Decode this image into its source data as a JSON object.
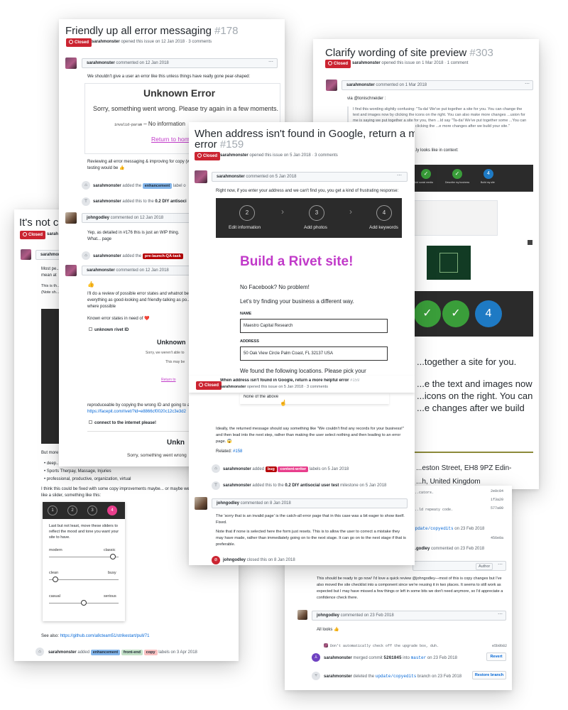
{
  "card1": {
    "title": "Friendly up all error messaging",
    "number": "#178",
    "status": "Closed",
    "meta_user": "sarahmonster",
    "meta_text": "opened this issue on 12 Jan 2018 · 3 comments",
    "comment1": {
      "user": "sarahmonster",
      "date": "commented on 12 Jan 2018"
    },
    "intro": "We shouldn't give a user an error like this unless things have really gone pear-shaped:",
    "err_title": "Unknown Error",
    "err_text": "Sorry, something went wrong. Please try again in a few moments.",
    "err_code_prefix": "invalid-param",
    "err_code_suffix": "– No information",
    "err_link": "Return to hom",
    "review_text": "Reviewing all error messaging & improving for copy (w... testing would be 👍",
    "event1": {
      "user": "sarahmonster",
      "pre": "added the",
      "label": "enhancement",
      "post": "label o"
    },
    "event2": {
      "user": "sarahmonster",
      "pre": "added this to the",
      "milestone": "0.2 DIY antisoci"
    },
    "comment2": {
      "user": "johngodley",
      "date": "commented on 12 Jan 2018"
    },
    "comment2_text": "Yep, as detailed in #176 this is just an WIP thing. What... page",
    "comment2_link": "#176",
    "event3": {
      "user": "sarahmonster",
      "pre": "added the",
      "label": "pre-launch-QA-task"
    },
    "comment3": {
      "user": "sarahmonster",
      "date": "commented on 12 Jan 2018"
    },
    "thumb": "👍",
    "comment3_text": "I'll do a review of possible error states and whatnot be... everything as good-looking and friendly-talking as po... where possible",
    "known_states": "Known error states in need of ❤️",
    "unknown_rivet": "unknown rivet ID",
    "mini_title": "Unknown",
    "mini_sub": "Sorry, we weren't able to",
    "mini_small": "This may be",
    "mini_link": "Return to",
    "repro_text": "reproduceable by copying the wrong ID and going to a...",
    "repro_link": "https://facepit.com/rivet/?id=e8866cf0020c12c3e3d2",
    "connect": "connect to the internet please!",
    "mini2_title": "Unkn",
    "mini2_text": "Sorry, something went wrong"
  },
  "card2": {
    "title": "Clarify wording of site preview",
    "number": "#303",
    "status": "Closed",
    "meta_user": "sarahmonster",
    "meta_text": "opened this issue on 1 Mar 2018 · 1 comment",
    "comment1": {
      "user": "sarahmonster",
      "date": "commented on 1 Mar 2018"
    },
    "via": "via @tonischneider :",
    "quote": "I find this wording slightly confusing: \"Ta-da! We've put together a site for you. You can change the text and images now by clicking the icons on the right. You can also make more changes ...usion for me is saying we put together a site for you, then ...ld say \"Ta-da! We've put together some ...You can change the text and images now by clicking the ...e more changes after we build your site.\"",
    "context": "...ly looks like in context:",
    "steps_labels": [
      "Add social media",
      "Describe my business",
      "Build my site"
    ],
    "big_text1": "...together a site for you.",
    "big_text2": "...e the text and images now ...icons on the right. You can ...e changes after we build",
    "addr1": "...eston Street, EH8 9PZ Edin-",
    "addr2": "...h, United Kingdom",
    "commit_lines": [
      "...cators.",
      "...",
      "...ld repeaty code."
    ],
    "hashes": [
      "2e0c04",
      "1f3a20",
      "577a00"
    ],
    "branch": "update/copyedits",
    "branch_date": "on 23 Feb 2018",
    "hash4": "456e0a",
    "c_user": "...godley",
    "c_date": "commented on 23 Feb 2018",
    "author_badge": "Author",
    "ready_text": "This should be ready to go now! I'd love a quick review @johngodley—most of this is copy changes but I've also moved the site checklist into a component since we're reusing it in two places. It seems to still work as expected but I may have missed a few things or left in some bits we don't need anymore, so I'd appreciate a confidence check there.",
    "c2_user": "johngodley",
    "c2_date": "commented on 23 Feb 2018",
    "c2_text": "All looks 👍",
    "commit_msg": "Don't automatically check off the upgrade box, duh.",
    "commit_hash": "e5b0b82",
    "merge_user": "sarahmonster",
    "merge_text": "merged commit",
    "merge_hash": "5261845",
    "merge_into": "into",
    "merge_branch": "master",
    "merge_date": "on 23 Feb 2018",
    "revert": "Revert",
    "deleted_user": "sarahmonster",
    "deleted_text": "deleted the",
    "deleted_branch": "update/copyedits",
    "deleted_post": "branch on 23 Feb 2018",
    "restore": "Restore branch"
  },
  "card3": {
    "title": "It's not cle",
    "status": "Closed",
    "meta_user": "sarah",
    "c_user": "sarahmonster",
    "p1": "Most pe... mean at",
    "p2": "This is th... feel. (Note sh...",
    "but_most": "But more",
    "bullets": [
      "deep...",
      "Sports Therpay, Massage, Injuries",
      "professional, productive, organization, virtual"
    ],
    "fix_text": "I think this could be fixed with some copy improvements maybe... or maybe we'... more like a slider, something like this:",
    "slider_steps": [
      "1",
      "2",
      "3",
      "4"
    ],
    "slider_intro": "Last but not least, move these sliders to reflect the mood and tone you want your site to have.",
    "sliders": [
      {
        "left": "modern",
        "right": "classic",
        "pos": 0.95
      },
      {
        "left": "clean",
        "right": "busy",
        "pos": 0.05
      },
      {
        "left": "casual",
        "right": "serious",
        "pos": 0.5
      }
    ],
    "see_also": "See also:",
    "see_link": "https://github.com/a8cteam51/strikestart/pull/71",
    "ev_user": "sarahmonster",
    "ev_pre": "added",
    "labels": [
      "enhancement",
      "front-end",
      "copy"
    ],
    "ev_post": "labels on 3 Apr 2018"
  },
  "card4": {
    "title": "When address isn't found in Google, return a more helpfu...",
    "title2": "error",
    "number": "#159",
    "status": "Closed",
    "meta_user": "sarahmonster",
    "meta_text": "opened this issue on 5 Jan 2018 · 3 comments",
    "comment1": {
      "user": "sarahmonster",
      "date": "commented on 5 Jan 2018"
    },
    "intro": "Right now, if you enter your address and we can't find you, you get a kind of frustrating response:",
    "steps": [
      {
        "n": "2",
        "label": "Edit information"
      },
      {
        "n": "3",
        "label": "Add photos"
      },
      {
        "n": "4",
        "label": "Add keywords"
      }
    ],
    "rivet_title": "Build a Rivet site!",
    "no_fb": "No Facebook? No problem!",
    "try_text": "Let's try finding your business a different way.",
    "name_label": "NAME",
    "name_value": "Maestro Capital Research",
    "address_label": "ADDRESS",
    "address_value": "50 Oak View Circle Palm Coast, FL 32137 USA",
    "found_text": "We found the following locations. Please pick your",
    "sticky_title": "When address isn't found in Google, return a more helpful error",
    "sticky_num": "#159",
    "sticky_user": "sarahmonster",
    "sticky_meta": "opened this issue on 5 Jan 2018 · 3 comments",
    "none_above": "None of the above",
    "ideally": "Ideally, the returned message should say something like \"We couldn't find any records for your business!\" and then lead into the next step, rather than making the user select nothing and then leading to an error page. 😱",
    "related": "Related:",
    "related_link": "#158",
    "ev1_user": "sarahmonster",
    "ev1_pre": "added",
    "ev1_labels": [
      "bug",
      "content-writer"
    ],
    "ev1_post": "labels on 5 Jan 2018",
    "ev2_user": "sarahmonster",
    "ev2_pre": "added this to the",
    "ev2_milestone": "0.2 DIY antisocial user test",
    "ev2_post": "milestone on 5 Jan 2018",
    "comment2": {
      "user": "johngodley",
      "date": "commented on 8 Jan 2018"
    },
    "c2_p1": "The 'sorry that is an invalid page' is the catch-all error page that in this case was a bit eager to show itself. Fixed.",
    "c2_p2": "Note that if none is selected here the form just resets. This is to allow the user to correct a mistake they may have made, rather than immediately going on to the next stage. It can go on to the next stage if that is preferable.",
    "closed_user": "johngodley",
    "closed_text": "closed this on 8 Jan 2018"
  },
  "colors": {
    "closed": "#cb2431",
    "link": "#0366d6",
    "rivet": "#c13ac9",
    "green": "#2ea043",
    "blue": "#0366d6",
    "pink": "#e83e8c"
  },
  "icons": [
    "kebab-icon",
    "smiley-icon",
    "tag-icon",
    "milestone-icon",
    "merge-icon",
    "branch-icon",
    "closed-icon",
    "chevron-right-icon",
    "check-icon"
  ]
}
